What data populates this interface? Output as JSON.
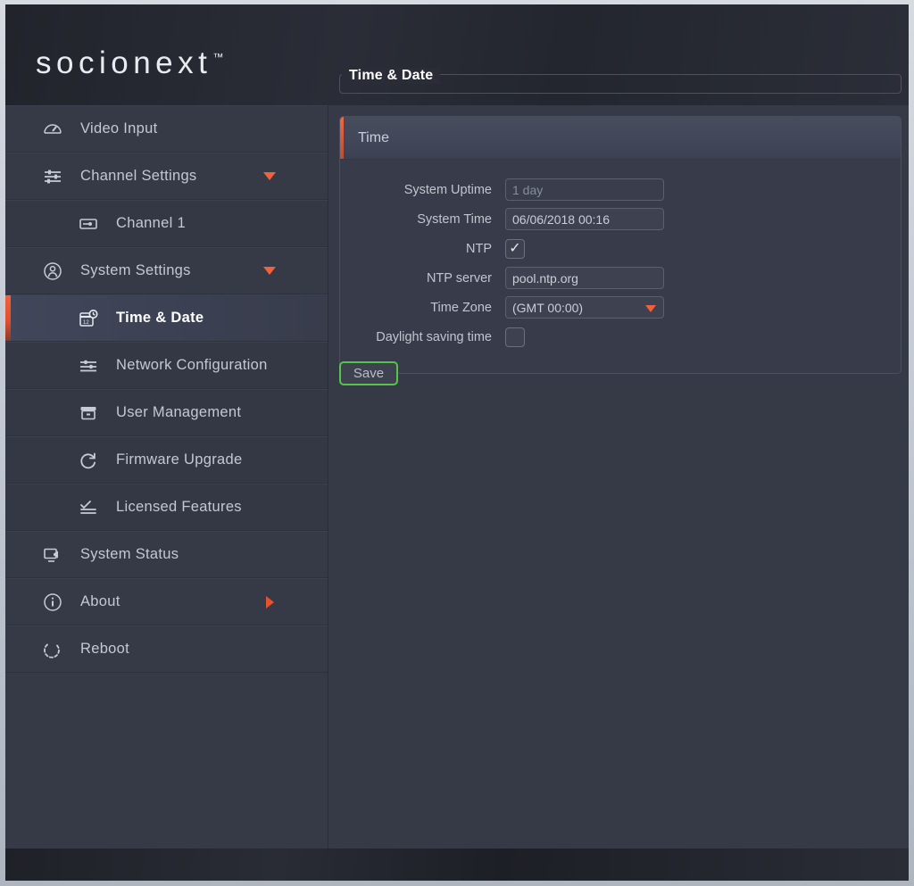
{
  "brand": {
    "name": "socionext",
    "tm": "™"
  },
  "page": {
    "title": "Time & Date"
  },
  "sidebar": {
    "items": [
      {
        "label": "Video Input",
        "icon": "gauge-icon",
        "level": "top",
        "arrow": "none",
        "active": false
      },
      {
        "label": "Channel Settings",
        "icon": "sliders-icon",
        "level": "top",
        "arrow": "down",
        "active": false
      },
      {
        "label": "Channel 1",
        "icon": "channel-icon",
        "level": "sub",
        "arrow": "none",
        "active": false
      },
      {
        "label": "System Settings",
        "icon": "user-icon",
        "level": "top",
        "arrow": "down",
        "active": false
      },
      {
        "label": "Time & Date",
        "icon": "calendar-clock-icon",
        "level": "sub",
        "arrow": "none",
        "active": true
      },
      {
        "label": "Network Configuration",
        "icon": "network-icon",
        "level": "sub",
        "arrow": "none",
        "active": false
      },
      {
        "label": "User Management",
        "icon": "users-box-icon",
        "level": "sub",
        "arrow": "none",
        "active": false
      },
      {
        "label": "Firmware Upgrade",
        "icon": "refresh-icon",
        "level": "sub",
        "arrow": "none",
        "active": false
      },
      {
        "label": "Licensed Features",
        "icon": "checklist-icon",
        "level": "sub",
        "arrow": "none",
        "active": false
      },
      {
        "label": "System Status",
        "icon": "monitor-icon",
        "level": "top",
        "arrow": "none",
        "active": false
      },
      {
        "label": "About",
        "icon": "info-icon",
        "level": "top",
        "arrow": "right",
        "active": false
      },
      {
        "label": "Reboot",
        "icon": "reboot-icon",
        "level": "top",
        "arrow": "none",
        "active": false
      }
    ]
  },
  "panel": {
    "title": "Time",
    "fields": {
      "system_uptime": {
        "label": "System Uptime",
        "value": "1 day"
      },
      "system_time": {
        "label": "System Time",
        "value": "06/06/2018 00:16"
      },
      "ntp": {
        "label": "NTP",
        "checked": true,
        "tick": "✓"
      },
      "ntp_server": {
        "label": "NTP server",
        "value": "pool.ntp.org"
      },
      "time_zone": {
        "label": "Time Zone",
        "value": "(GMT 00:00)"
      },
      "daylight": {
        "label": "Daylight saving time",
        "checked": false,
        "tick": "✓"
      }
    }
  },
  "actions": {
    "save_label": "Save"
  },
  "colors": {
    "accent_orange": "#f2603c",
    "save_border_green": "#56c44a",
    "background": "#363a47",
    "panel": "#383c4a",
    "text": "#c3c8d2"
  }
}
